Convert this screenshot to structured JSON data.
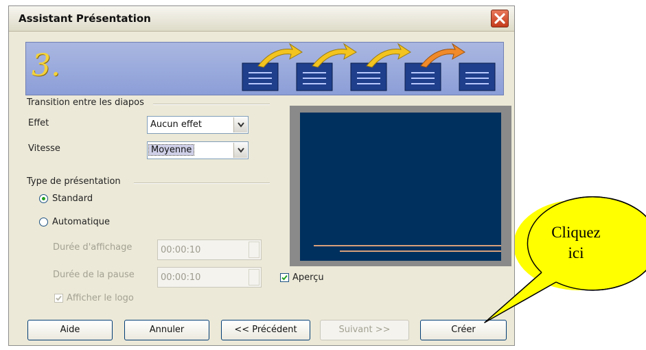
{
  "window": {
    "title": "Assistant Présentation"
  },
  "banner": {
    "step_number": "3."
  },
  "transition": {
    "group_label": "Transition entre les diapos",
    "effect_label": "Effet",
    "effect_value": "Aucun effet",
    "speed_label": "Vitesse",
    "speed_value": "Moyenne"
  },
  "presentation_type": {
    "group_label": "Type de présentation",
    "standard_label": "Standard",
    "standard_selected": true,
    "automatic_label": "Automatique",
    "display_duration_label": "Durée d'affichage",
    "display_duration_value": "00:00:10",
    "pause_duration_label": "Durée de la pause",
    "pause_duration_value": "00:00:10",
    "show_logo_label": "Afficher le logo",
    "show_logo_checked": true
  },
  "preview": {
    "label": "Aperçu",
    "checked": true
  },
  "buttons": {
    "help": "Aide",
    "cancel": "Annuler",
    "previous": "<< Précédent",
    "next": "Suivant >>",
    "create": "Créer"
  },
  "callout": {
    "line1": "Cliquez",
    "line2": "ici",
    "fill_color": "#ffff00"
  },
  "colors": {
    "banner": "#98a8dc",
    "preview_background": "#00305e",
    "accent_arrow": "#f3c41f"
  }
}
